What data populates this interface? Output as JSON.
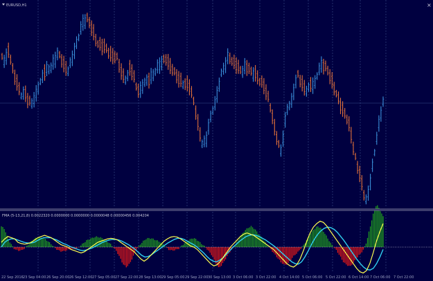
{
  "window": {
    "title": "EURUSD,H1",
    "close_symbol": "×"
  },
  "indicator": {
    "title": "FMA (5-13,21,8) 0.0022320 0.0000000 0.0000000 0.0000048 0.00000456 0.004204"
  },
  "colors": {
    "background": "#000040",
    "grid": "#3a4f8c",
    "separator": "#7a7a9a",
    "bull": "#3a8fd9",
    "bear": "#e0703a",
    "hist_pos": "#1f9a1f",
    "hist_neg": "#e01818",
    "signal_fast": "#ffff50",
    "signal_slow": "#30d0f0",
    "zero_line": "#ffffff"
  },
  "icons": [
    "dropdown-triangle-icon",
    "close-icon"
  ],
  "time_axis": {
    "labels": [
      "22 Sep 2016",
      "23 Sep 04:00",
      "26 Sep 20:00",
      "26 Sep 12:00",
      "27 Sep 05:00",
      "27 Sep 22:00",
      "28 Sep 13:00",
      "29 Sep 05:00",
      "29 Sep 22:00",
      "30 Sep 13:00",
      "3 Oct 06:00",
      "3 Oct 22:00",
      "4 Oct 14:00",
      "5 Oct 06:00",
      "5 Oct 22:00",
      "6 Oct 14:00",
      "7 Oct 06:00",
      "7 Oct 22:00"
    ]
  },
  "chart_data": {
    "type": "bar",
    "instrument": "EURUSD",
    "timeframe": "H1",
    "price_trace": [
      80,
      90,
      72,
      96,
      110,
      128,
      140,
      132,
      146,
      150,
      143,
      124,
      115,
      104,
      100,
      95,
      88,
      78,
      83,
      95,
      104,
      90,
      72,
      58,
      42,
      30,
      25,
      37,
      52,
      62,
      64,
      68,
      73,
      78,
      80,
      85,
      100,
      110,
      115,
      98,
      108,
      126,
      134,
      122,
      116,
      112,
      110,
      100,
      92,
      88,
      86,
      95,
      98,
      110,
      116,
      120,
      120,
      125,
      140,
      160,
      188,
      210,
      205,
      178,
      160,
      150,
      122,
      100,
      95,
      80,
      88,
      90,
      100,
      104,
      95,
      97,
      108,
      105,
      113,
      120,
      128,
      140,
      160,
      188,
      206,
      218,
      180,
      155,
      150,
      124,
      108,
      120,
      126,
      130,
      122,
      126,
      105,
      94,
      96,
      100,
      110,
      126,
      140,
      150,
      160,
      172,
      188,
      214,
      236,
      255,
      278,
      290,
      265,
      235,
      200,
      170,
      148
    ],
    "histogram": [
      30,
      26,
      12,
      4,
      -3,
      -5,
      -5,
      -2,
      3,
      8,
      12,
      14,
      14,
      13,
      9,
      5,
      0,
      -4,
      -6,
      -6,
      -4,
      -3,
      -3,
      -2,
      2,
      6,
      10,
      12,
      14,
      15,
      14,
      12,
      9,
      5,
      0,
      -6,
      -15,
      -25,
      -29,
      -24,
      -14,
      -4,
      3,
      8,
      12,
      13,
      12,
      10,
      8,
      5,
      0,
      -4,
      -5,
      -4,
      -2,
      3,
      7,
      10,
      13,
      12,
      8,
      4,
      0,
      -6,
      -12,
      -22,
      -30,
      -26,
      -18,
      -10,
      -3,
      3,
      10,
      18,
      24,
      28,
      30,
      26,
      20,
      14,
      8,
      2,
      -4,
      -10,
      -16,
      -22,
      -26,
      -24,
      -18,
      -12,
      -8,
      -2,
      4,
      12,
      20,
      26,
      30,
      28,
      22,
      14,
      6,
      0,
      -6,
      -14,
      -22,
      -26,
      -28,
      -22,
      -16,
      -10,
      -4,
      8,
      28,
      48,
      62,
      54,
      44
    ],
    "signal_fast": [
      8,
      14,
      18,
      16,
      14,
      8,
      6,
      5,
      6,
      8,
      12,
      16,
      18,
      20,
      18,
      16,
      12,
      8,
      4,
      2,
      0,
      -4,
      -6,
      -8,
      -10,
      -8,
      -4,
      0,
      4,
      8,
      10,
      12,
      14,
      15,
      14,
      12,
      8,
      4,
      0,
      -4,
      -8,
      -14,
      -20,
      -24,
      -20,
      -14,
      -8,
      -2,
      4,
      10,
      14,
      17,
      18,
      17,
      14,
      10,
      6,
      2,
      0,
      -4,
      -10,
      -16,
      -22,
      -28,
      -32,
      -30,
      -24,
      -16,
      -8,
      0,
      6,
      12,
      18,
      22,
      24,
      22,
      20,
      16,
      12,
      8,
      4,
      0,
      -4,
      -10,
      -16,
      -22,
      -28,
      -32,
      -34,
      -30,
      -20,
      -6,
      10,
      24,
      34,
      40,
      44,
      42,
      36,
      28,
      20,
      12,
      4,
      -4,
      -12,
      -20,
      -28,
      -36,
      -42,
      -44,
      -40,
      -28,
      -10,
      10,
      26,
      40
    ],
    "signal_slow": [
      0,
      8,
      12,
      14,
      14,
      12,
      10,
      8,
      7,
      7,
      8,
      11,
      14,
      16,
      16,
      16,
      14,
      12,
      9,
      6,
      4,
      1,
      -1,
      -3,
      -5,
      -6,
      -5,
      -3,
      -1,
      2,
      5,
      8,
      10,
      12,
      13,
      13,
      12,
      10,
      7,
      4,
      0,
      -4,
      -9,
      -14,
      -17,
      -16,
      -13,
      -9,
      -5,
      -1,
      3,
      7,
      10,
      13,
      15,
      15,
      13,
      10,
      7,
      4,
      0,
      -5,
      -10,
      -16,
      -21,
      -24,
      -25,
      -22,
      -18,
      -12,
      -6,
      0,
      5,
      10,
      14,
      18,
      20,
      21,
      20,
      18,
      15,
      12,
      8,
      4,
      0,
      -5,
      -10,
      -15,
      -20,
      -25,
      -28,
      -29,
      -25,
      -17,
      -7,
      4,
      14,
      22,
      28,
      32,
      34,
      33,
      30,
      25,
      18,
      11,
      3,
      -5,
      -13,
      -21,
      -28,
      -34,
      -38,
      -39,
      -36,
      -28,
      -17,
      -4
    ]
  }
}
